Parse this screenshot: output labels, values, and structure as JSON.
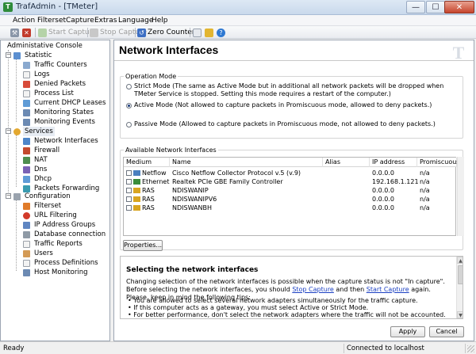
{
  "window": {
    "title": "TrafAdmin - [TMeter]",
    "app_icon_glyph": "T",
    "controls": {
      "minimize": "—",
      "maximize": "☐",
      "close": "✕"
    }
  },
  "menu": [
    "Action",
    "Filterset",
    "Capture",
    "Extras",
    "Language",
    "Help"
  ],
  "toolbar": {
    "start_capture": "Start Capture",
    "stop_capture": "Stop Capture",
    "zero_counters": "Zero Counters"
  },
  "tree": {
    "root": "Administative Console",
    "statistic": {
      "label": "Statistic",
      "items": [
        "Traffic Counters",
        "Logs",
        "Denied Packets",
        "Process List",
        "Current DHCP Leases",
        "Monitoring States",
        "Monitoring Events"
      ]
    },
    "services": {
      "label": "Services",
      "items": [
        "Network Interfaces",
        "Firewall",
        "NAT",
        "Dns",
        "Dhcp",
        "Packets Forwarding"
      ]
    },
    "configuration": {
      "label": "Configuration",
      "items": [
        "Filterset",
        "URL Filtering",
        "IP Address Groups",
        "Database connection",
        "Traffic Reports",
        "Users",
        "Process Definitions",
        "Host Monitoring"
      ]
    },
    "selected": "Network Interfaces",
    "expanded_glyph": "−"
  },
  "main": {
    "title": "Network Interfaces",
    "logo_letter": "T",
    "operation_mode": {
      "label": "Operation Mode",
      "options": [
        {
          "text": "Strict Mode (The same as Active Mode but in additional all network packets will be dropped when TMeter Service is stopped. Setting this mode requires a restart of the computer.)",
          "checked": false
        },
        {
          "text": "Active Mode (Not allowed to capture packets in Promiscuous mode, allowed to deny packets.)",
          "checked": true
        },
        {
          "text": "Passive Mode (Allowed to capture packets in Promiscuous mode, not allowed to deny packets.)",
          "checked": false
        }
      ]
    },
    "interfaces": {
      "label": "Available Network Interfaces",
      "columns": [
        "Medium",
        "Name",
        "Alias",
        "IP address",
        "Promiscuous"
      ],
      "rows": [
        {
          "medium": "Netflow",
          "name": "Cisco Netflow Collector Protocol v.5 (v.9)",
          "alias": "",
          "ip": "0.0.0.0",
          "promiscuous": "n/a",
          "icon_color": "#4a7fbf"
        },
        {
          "medium": "Ethernet",
          "name": "Realtek PCIe GBE Family Controller",
          "alias": "",
          "ip": "192.168.1.121",
          "promiscuous": "n/a",
          "icon_color": "#3a8c3a"
        },
        {
          "medium": "RAS",
          "name": "NDISWANIP",
          "alias": "",
          "ip": "0.0.0.0",
          "promiscuous": "n/a",
          "icon_color": "#d9a520"
        },
        {
          "medium": "RAS",
          "name": "NDISWANIPV6",
          "alias": "",
          "ip": "0.0.0.0",
          "promiscuous": "n/a",
          "icon_color": "#d9a520"
        },
        {
          "medium": "RAS",
          "name": "NDISWANBH",
          "alias": "",
          "ip": "0.0.0.0",
          "promiscuous": "n/a",
          "icon_color": "#d9a520"
        }
      ],
      "properties_button": "Properties..."
    },
    "help": {
      "title": "Selecting the network interfaces",
      "para_before_stop": "Changing selection of the network interfaces is possible when the capture status is not \"In capture\". Before selecting the network interfaces, you should ",
      "stop_link": "Stop Capture",
      "para_between": " and then ",
      "start_link": "Start Capture",
      "para_after": " again. Please, keep in mind the following tips:",
      "tips": [
        "You are allowed to select several network adapters simultaneously for the traffic capture.",
        "If this computer acts as a gateway, you must select Active or Strict Mode.",
        "For better performance, don't select the network adapters where the traffic will not be accounted."
      ]
    },
    "apply_button": "Apply",
    "cancel_button": "Cancel"
  },
  "status": {
    "left": "Ready",
    "right": "Connected to localhost"
  }
}
